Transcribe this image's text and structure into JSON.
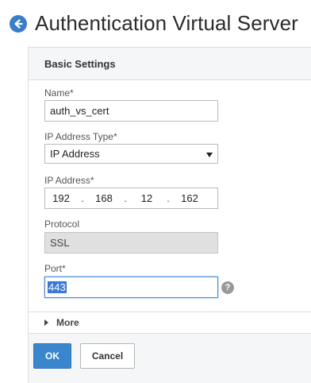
{
  "header": {
    "title": "Authentication Virtual Server",
    "back_icon": "arrow-left-icon"
  },
  "panel": {
    "title": "Basic Settings"
  },
  "form": {
    "name": {
      "label": "Name*",
      "value": "auth_vs_cert"
    },
    "ip_type": {
      "label": "IP Address Type*",
      "value": "IP Address"
    },
    "ip_address": {
      "label": "IP Address*",
      "octets": [
        "192",
        "168",
        "12",
        "162"
      ],
      "separator": "."
    },
    "protocol": {
      "label": "Protocol",
      "value": "SSL"
    },
    "port": {
      "label": "Port*",
      "value": "443",
      "help": "?"
    }
  },
  "more": {
    "label": "More"
  },
  "buttons": {
    "ok": "OK",
    "cancel": "Cancel"
  },
  "colors": {
    "accent": "#3a86cc",
    "selection": "#3b78d8",
    "panel_header": "#f5f6f8",
    "readonly_bg": "#e0e0e0"
  }
}
